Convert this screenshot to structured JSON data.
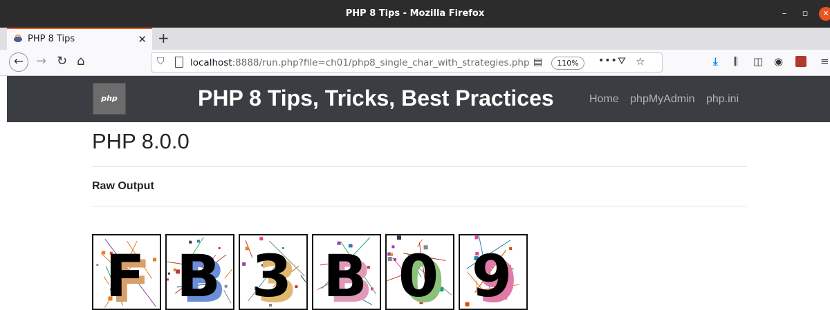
{
  "window": {
    "title": "PHP 8 Tips - Mozilla Firefox"
  },
  "tab": {
    "label": "PHP 8 Tips"
  },
  "address_bar": {
    "host": "localhost",
    "path": ":8888/run.php?file=ch01/php8_single_char_with_strategies.php",
    "zoom": "110%"
  },
  "site": {
    "logo_text": "php",
    "title": "PHP 8 Tips, Tricks, Best Practices",
    "nav": [
      "Home",
      "phpMyAdmin",
      "php.ini"
    ]
  },
  "content": {
    "version": "PHP 8.0.0",
    "section_label": "Raw Output"
  },
  "captcha": {
    "characters": [
      "F",
      "B",
      "3",
      "B",
      "0",
      "9"
    ],
    "shadow_colors": [
      "#d8a068",
      "#6a8fd8",
      "#e0b870",
      "#e09ab8",
      "#8cc07a",
      "#e07aa8"
    ]
  },
  "icons": {
    "back": "back-arrow-icon",
    "forward": "forward-arrow-icon",
    "reload": "reload-icon",
    "home": "home-icon",
    "shield": "shield-icon",
    "reader": "reader-view-icon",
    "more": "more-icon",
    "pocket": "pocket-icon",
    "star": "bookmark-star-icon",
    "download": "download-icon",
    "library": "library-icon",
    "sidebar": "sidebar-icon",
    "account": "account-icon",
    "menu": "hamburger-menu-icon"
  },
  "colors": {
    "header_bg": "#3a3d41",
    "accent": "#e95420"
  }
}
